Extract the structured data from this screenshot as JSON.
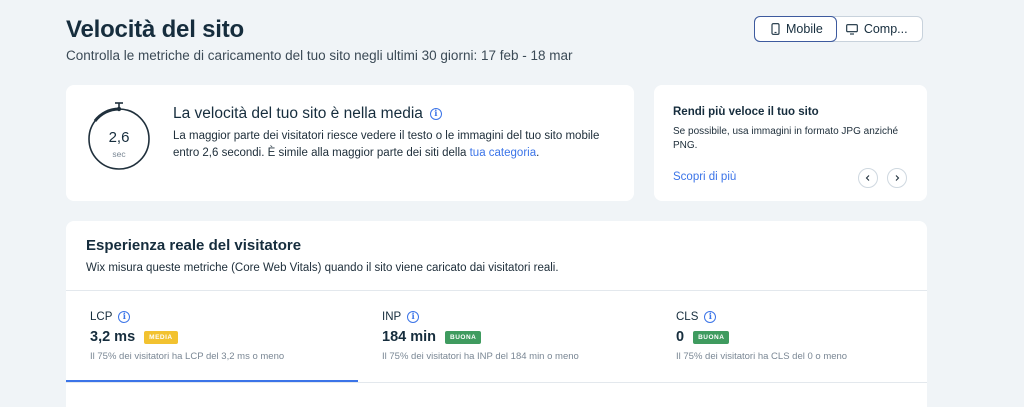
{
  "header": {
    "title": "Velocità del sito",
    "subtitle": "Controlla le metriche di caricamento del tuo sito negli ultimi 30 giorni: 17 feb - 18 mar"
  },
  "device_toggle": {
    "mobile_label": "Mobile",
    "desktop_label": "Comp...",
    "selected": "Mobile",
    "accent": "#3d5a9e"
  },
  "speed_card": {
    "value": "2,6",
    "unit": "sec",
    "title": "La velocità del tuo sito è nella media",
    "description_pre": "La maggior parte dei visitatori riesce vedere il testo o le immagini del tuo sito mobile entro 2,6 secondi. È simile alla maggior parte dei siti della ",
    "description_link": "tua categoria",
    "description_post": "."
  },
  "tip_card": {
    "title": "Rendi più veloce il tuo sito",
    "description": "Se possibile, usa immagini in formato JPG anziché PNG.",
    "link": "Scopri di più",
    "prev_icon": "chevron-left-icon",
    "next_icon": "chevron-right-icon"
  },
  "experience": {
    "title": "Esperienza reale del visitatore",
    "description": "Wix misura queste metriche (Core Web Vitals) quando il sito viene caricato dai visitatori reali.",
    "metrics": [
      {
        "label": "LCP",
        "value": "3,2 ms",
        "badge": "MEDIA",
        "badge_color": "#f2c230",
        "note": "Il 75% dei visitatori ha LCP del 3,2 ms o meno",
        "active": true
      },
      {
        "label": "INP",
        "value": "184 min",
        "badge": "BUONA",
        "badge_color": "#3f9b5f",
        "note": "Il 75% dei visitatori ha INP del 184 min o meno",
        "active": false
      },
      {
        "label": "CLS",
        "value": "0",
        "badge": "BUONA",
        "badge_color": "#3f9b5f",
        "note": "Il 75% dei visitatori ha CLS del 0 o meno",
        "active": false
      }
    ]
  },
  "colors": {
    "link": "#3b74e8",
    "background": "#f0f4f7",
    "title": "#162d3d"
  }
}
